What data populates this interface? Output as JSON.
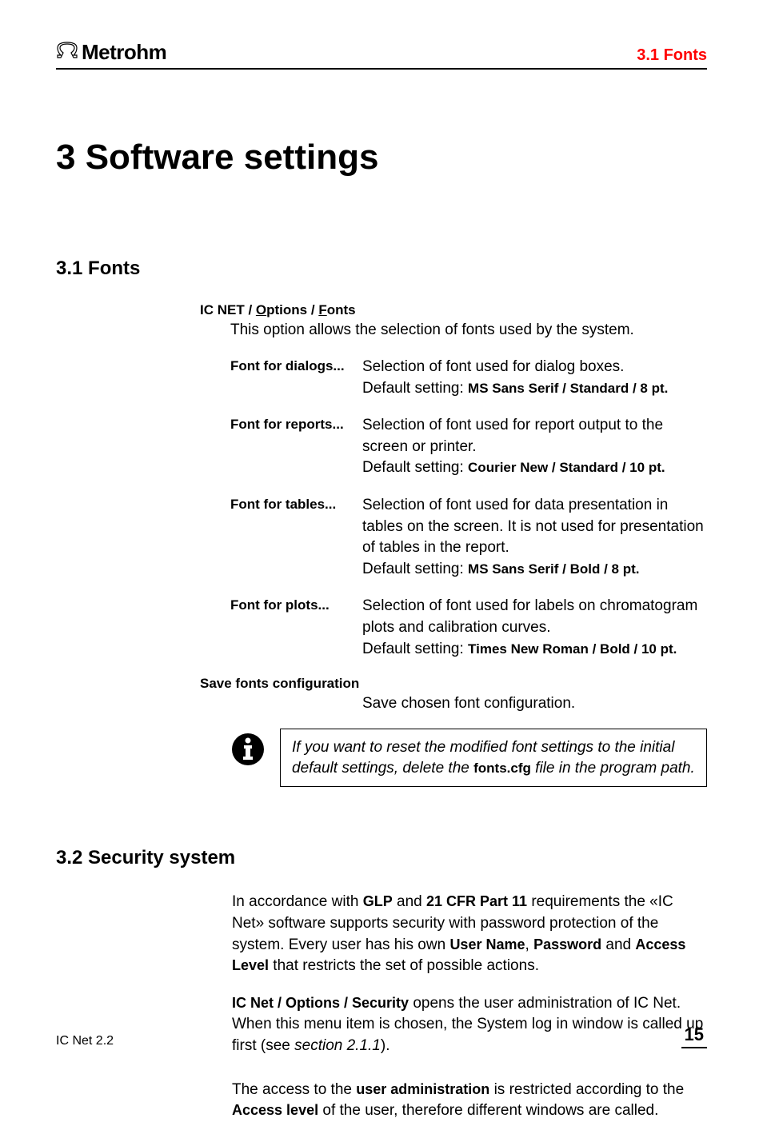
{
  "header": {
    "logo_text": "Metrohm",
    "section_ref": "3.1  Fonts"
  },
  "chapter": {
    "title": "3  Software settings"
  },
  "section1": {
    "heading": "3.1   Fonts",
    "menu_path_prefix": "IC NET / ",
    "menu_path_u1": "O",
    "menu_path_mid": "ptions / ",
    "menu_path_u2": "F",
    "menu_path_end": "onts",
    "intro": "This option allows the selection of fonts used by the system.",
    "items": [
      {
        "term": "Font for dialogs...",
        "desc": "Selection of font used for dialog boxes.",
        "default_prefix": "Default setting: ",
        "default_value": "MS Sans Serif / Standard / 8 pt."
      },
      {
        "term": "Font for reports...",
        "desc": "Selection of font used for report output to the screen or printer.",
        "default_prefix": "Default setting: ",
        "default_value": "Courier New / Standard / 10 pt."
      },
      {
        "term": "Font for tables...",
        "desc": "Selection of font used for data presentation in tables on the screen. It is not used for presentation of tables in the report.",
        "default_prefix": "Default setting: ",
        "default_value": "MS Sans Serif / Bold / 8 pt."
      },
      {
        "term": "Font for plots...",
        "desc": "Selection of font used for labels on chromatogram plots and calibration curves.",
        "default_prefix": "Default setting: ",
        "default_value": "Times New Roman / Bold / 10 pt."
      }
    ],
    "save_heading": "Save fonts configuration",
    "save_desc": "Save chosen font configuration.",
    "info_pre": "If you want to reset the modified font settings to the initial default settings, delete the ",
    "info_bold": "fonts.cfg",
    "info_post": " file in the program path."
  },
  "section2": {
    "heading": "3.2   Security system",
    "p1_a": "In accordance with ",
    "p1_b1": "GLP",
    "p1_b": " and ",
    "p1_b2": "21 CFR Part 11",
    "p1_c": " requirements the «IC Net» software supports security with password protection of the system. Every user has his own ",
    "p1_d1": "User Name",
    "p1_d": ", ",
    "p1_d2": "Password",
    "p1_e": " and ",
    "p1_d3": "Access Level",
    "p1_f": " that restricts the set of possible actions.",
    "p2_b1": "IC Net / Options / Security",
    "p2_a": " opens the user administration of IC Net. When this menu item is chosen, the System log in window is called up first (see ",
    "p2_i": "section 2.1.1",
    "p2_b": ").",
    "p3_a": "The access to the ",
    "p3_b1": "user administration",
    "p3_b": " is restricted according to the ",
    "p3_b2": "Access level",
    "p3_c": " of the user, therefore different windows are called."
  },
  "footer": {
    "left": "IC Net 2.2",
    "page": "15"
  }
}
